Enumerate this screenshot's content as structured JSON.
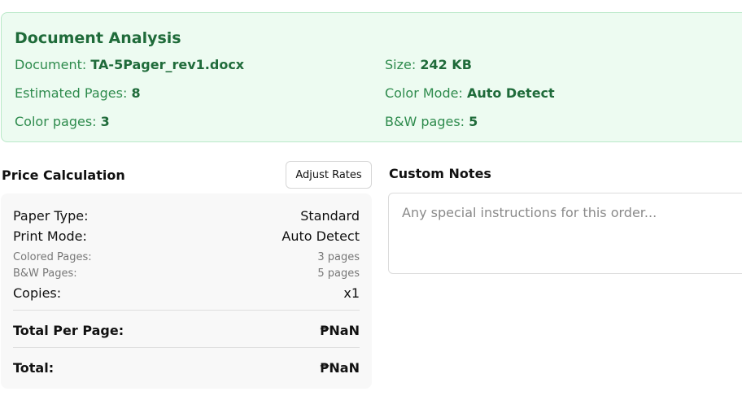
{
  "analysis": {
    "title": "Document Analysis",
    "document_label": "Document: ",
    "document_value": "TA-5Pager_rev1.docx",
    "size_label": "Size: ",
    "size_value": "242 KB",
    "pages_label": "Estimated Pages: ",
    "pages_value": "8",
    "color_mode_label": "Color Mode: ",
    "color_mode_value": "Auto Detect",
    "color_pages_label": "Color pages: ",
    "color_pages_value": "3",
    "bw_pages_label": "B&W pages: ",
    "bw_pages_value": "5"
  },
  "price": {
    "heading": "Price Calculation",
    "adjust_button": "Adjust Rates",
    "rows": {
      "paper_type_label": "Paper Type:",
      "paper_type_value": "Standard",
      "print_mode_label": "Print Mode:",
      "print_mode_value": "Auto Detect",
      "colored_pages_label": "Colored Pages:",
      "colored_pages_value": "3 pages",
      "bw_pages_label": "B&W Pages:",
      "bw_pages_value": "5 pages",
      "copies_label": "Copies:",
      "copies_value": "x1",
      "total_per_page_label": "Total Per Page:",
      "total_per_page_value": "₱NaN",
      "total_label": "Total:",
      "total_value": "₱NaN"
    }
  },
  "notes": {
    "heading": "Custom Notes",
    "placeholder": "Any special instructions for this order...",
    "value": ""
  },
  "colors": {
    "analysis_background": "#edfbf1",
    "analysis_border": "#b9e8c8",
    "analysis_title": "#1f6b3a",
    "analysis_text": "#2e8b4d",
    "panel_background": "#f8f8f8"
  }
}
